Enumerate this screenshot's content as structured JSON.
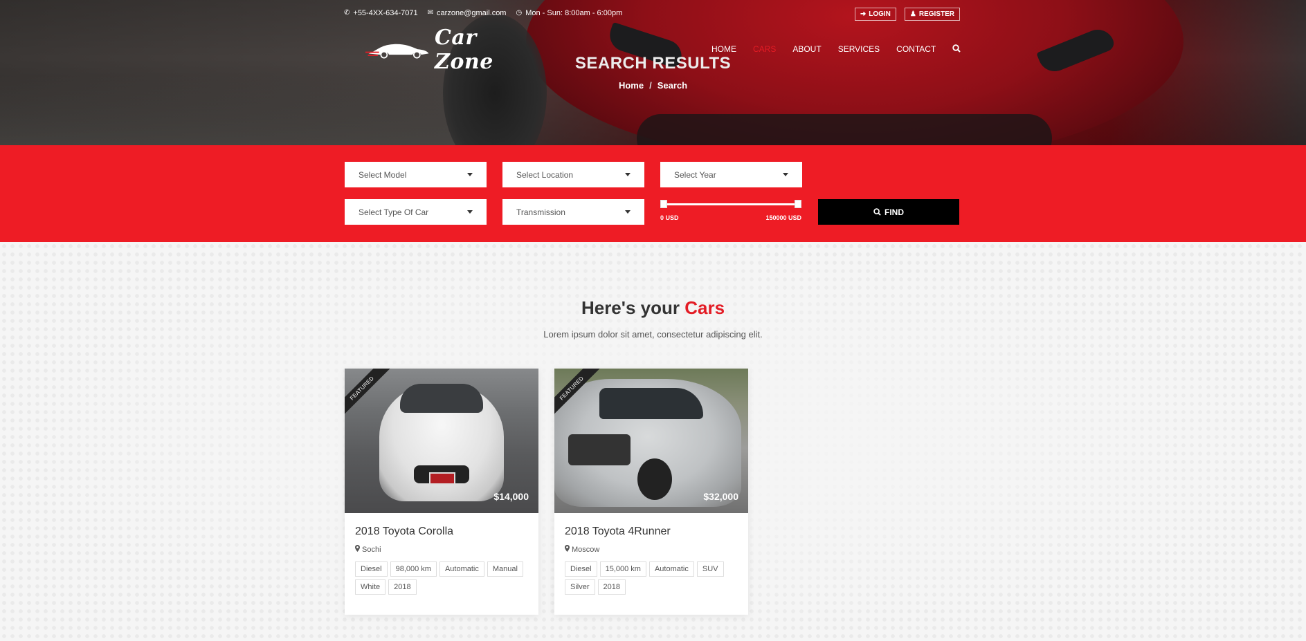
{
  "topbar": {
    "phone": "+55-4XX-634-7071",
    "email": "carzone@gmail.com",
    "hours": "Mon - Sun: 8:00am - 6:00pm",
    "login_label": "LOGIN",
    "register_label": "REGISTER"
  },
  "logo": {
    "text": "Car Zone"
  },
  "nav": {
    "items": [
      {
        "label": "HOME",
        "active": false
      },
      {
        "label": "CARS",
        "active": true
      },
      {
        "label": "ABOUT",
        "active": false
      },
      {
        "label": "SERVICES",
        "active": false
      },
      {
        "label": "CONTACT",
        "active": false
      }
    ],
    "search_icon": "search-icon"
  },
  "header": {
    "title": "SEARCH RESULTS",
    "breadcrumb": [
      "Home",
      "Search"
    ]
  },
  "filters": {
    "model": "Select Model",
    "location": "Select Location",
    "year": "Select Year",
    "type": "Select Type Of Car",
    "transmission": "Transmission",
    "price_min": "0 USD",
    "price_max": "150000 USD",
    "find_label": "FIND"
  },
  "section": {
    "title_prefix": "Here's your",
    "title_accent": "Cars",
    "subtitle": "Lorem ipsum dolor sit amet, consectetur adipiscing elit."
  },
  "cars": [
    {
      "badge": "FEATURED",
      "price": "$14,000",
      "name": "2018 Toyota Corolla",
      "location": "Sochi",
      "tags": [
        "Diesel",
        "98,000 km",
        "Automatic",
        "Manual",
        "White",
        "2018"
      ]
    },
    {
      "badge": "FEATURED",
      "price": "$32,000",
      "name": "2018 Toyota 4Runner",
      "location": "Moscow",
      "tags": [
        "Diesel",
        "15,000 km",
        "Automatic",
        "SUV",
        "Silver",
        "2018"
      ]
    }
  ],
  "colors": {
    "accent": "#ee1c25",
    "dark": "#000000"
  }
}
